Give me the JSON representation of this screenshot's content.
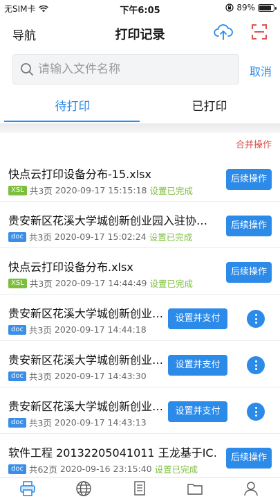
{
  "status_bar": {
    "carrier": "无SIM卡",
    "time": "下午6:05",
    "battery": "89%"
  },
  "nav": {
    "back_label": "导航",
    "title": "打印记录"
  },
  "search": {
    "placeholder": "请输入文件名称",
    "value": "",
    "cancel_label": "取消"
  },
  "tabs": [
    {
      "label": "待打印",
      "active": true
    },
    {
      "label": "已打印",
      "active": false
    }
  ],
  "merge_label": "合并操作",
  "items": [
    {
      "name": "快点云打印设备分布-15.xlsx",
      "type": "XSL",
      "pages": "共3页",
      "time": "2020-09-17 15:15:18",
      "status": "设置已完成",
      "action": "后续操作"
    },
    {
      "name": "贵安新区花溪大学城创新创业园入驻协…",
      "type": "doc",
      "pages": "共3页",
      "time": "2020-09-17 15:02:24",
      "status": "设置已完成",
      "action": "后续操作"
    },
    {
      "name": "快点云打印设备分布.xlsx",
      "type": "XSL",
      "pages": "共3页",
      "time": "2020-09-17 14:44:49",
      "status": "设置已完成",
      "action": "后续操作"
    },
    {
      "name": "贵安新区花溪大学城创新创业…",
      "type": "doc",
      "pages": "共3页",
      "time": "2020-09-17 14:44:18",
      "status": "",
      "action": "设置并支付"
    },
    {
      "name": "贵安新区花溪大学城创新创业…",
      "type": "doc",
      "pages": "共3页",
      "time": "2020-09-17 14:43:30",
      "status": "",
      "action": "设置并支付"
    },
    {
      "name": "贵安新区花溪大学城创新创业…",
      "type": "doc",
      "pages": "共3页",
      "time": "2020-09-17 14:43:13",
      "status": "",
      "action": "设置并支付"
    },
    {
      "name": "软件工程 20132205041011 王龙基于IC…",
      "type": "doc",
      "pages": "共62页",
      "time": "2020-09-16 23:15:40",
      "status": "设置已完成",
      "action": "后续操作"
    }
  ],
  "colors": {
    "accent": "#2c8ae8",
    "done": "#7cbf3c",
    "merge": "#d9534f"
  },
  "bottom_tabs": [
    "printer-icon",
    "globe-icon",
    "document-icon",
    "folder-icon",
    "user-icon"
  ]
}
